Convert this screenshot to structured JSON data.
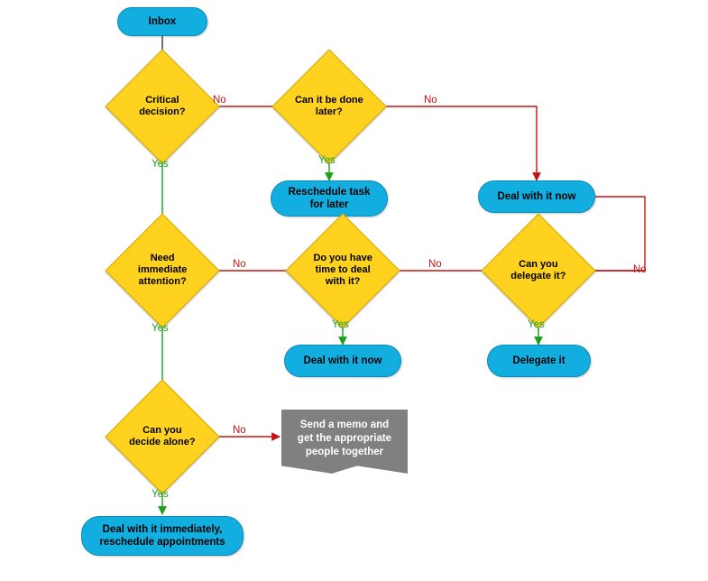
{
  "chart_data": {
    "type": "flowchart",
    "nodes": {
      "inbox": {
        "shape": "terminal",
        "label": "Inbox"
      },
      "critical": {
        "shape": "decision",
        "label": "Critical decision?"
      },
      "can_later": {
        "shape": "decision",
        "label": "Can it be done later?"
      },
      "reschedule_later": {
        "shape": "process",
        "label": "Reschedule task for later"
      },
      "deal_now_1": {
        "shape": "process",
        "label": "Deal with it now"
      },
      "need_attention": {
        "shape": "decision",
        "label": "Need immediate attention?"
      },
      "have_time": {
        "shape": "decision",
        "label": "Do you have time to deal with it?"
      },
      "deal_now_2": {
        "shape": "process",
        "label": "Deal with it now"
      },
      "can_delegate": {
        "shape": "decision",
        "label": "Can you delegate it?"
      },
      "delegate_it": {
        "shape": "process",
        "label": "Delegate it"
      },
      "decide_alone": {
        "shape": "decision",
        "label": "Can you decide alone?"
      },
      "send_memo": {
        "shape": "note",
        "label": "Send a memo and get the appropriate people together"
      },
      "deal_immediate": {
        "shape": "process",
        "label": "Deal with it immediately, reschedule appointments"
      }
    },
    "edges": [
      {
        "from": "inbox",
        "to": "critical",
        "label": null
      },
      {
        "from": "critical",
        "to": "need_attention",
        "label": "Yes"
      },
      {
        "from": "critical",
        "to": "can_later",
        "label": "No"
      },
      {
        "from": "can_later",
        "to": "reschedule_later",
        "label": "Yes"
      },
      {
        "from": "can_later",
        "to": "deal_now_1",
        "label": "No"
      },
      {
        "from": "deal_now_1",
        "to": "can_delegate",
        "label": "No"
      },
      {
        "from": "need_attention",
        "to": "decide_alone",
        "label": "Yes"
      },
      {
        "from": "need_attention",
        "to": "have_time",
        "label": "No"
      },
      {
        "from": "have_time",
        "to": "deal_now_2",
        "label": "Yes"
      },
      {
        "from": "have_time",
        "to": "can_delegate",
        "label": "No"
      },
      {
        "from": "can_delegate",
        "to": "delegate_it",
        "label": "Yes"
      },
      {
        "from": "can_delegate",
        "to": "deal_now_1",
        "label": "No"
      },
      {
        "from": "decide_alone",
        "to": "deal_immediate",
        "label": "Yes"
      },
      {
        "from": "decide_alone",
        "to": "send_memo",
        "label": "No"
      }
    ],
    "colors": {
      "decision_fill": "#ffd21f",
      "process_fill": "#13aee0",
      "note_fill": "#808080",
      "yes_edge": "#1aa11a",
      "no_edge": "#c21414",
      "default_edge": "#333333"
    }
  },
  "labels": {
    "yes": "Yes",
    "no": "No"
  }
}
